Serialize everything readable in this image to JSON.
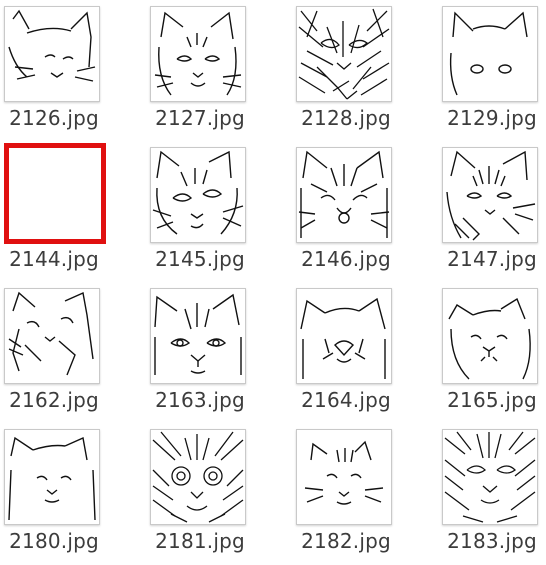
{
  "files": [
    {
      "name": "2126.jpg",
      "selected": false,
      "thumbnail": "cat-sketch-thumbnail"
    },
    {
      "name": "2127.jpg",
      "selected": false,
      "thumbnail": "cat-sketch-thumbnail"
    },
    {
      "name": "2128.jpg",
      "selected": false,
      "thumbnail": "cat-sketch-thumbnail"
    },
    {
      "name": "2129.jpg",
      "selected": false,
      "thumbnail": "cat-sketch-thumbnail"
    },
    {
      "name": "2144.jpg",
      "selected": true,
      "thumbnail": "blank-thumbnail"
    },
    {
      "name": "2145.jpg",
      "selected": false,
      "thumbnail": "cat-sketch-thumbnail"
    },
    {
      "name": "2146.jpg",
      "selected": false,
      "thumbnail": "cat-sketch-thumbnail"
    },
    {
      "name": "2147.jpg",
      "selected": false,
      "thumbnail": "cat-sketch-thumbnail"
    },
    {
      "name": "2162.jpg",
      "selected": false,
      "thumbnail": "cat-sketch-thumbnail"
    },
    {
      "name": "2163.jpg",
      "selected": false,
      "thumbnail": "cat-sketch-thumbnail"
    },
    {
      "name": "2164.jpg",
      "selected": false,
      "thumbnail": "cat-sketch-thumbnail"
    },
    {
      "name": "2165.jpg",
      "selected": false,
      "thumbnail": "cat-sketch-thumbnail"
    },
    {
      "name": "2180.jpg",
      "selected": false,
      "thumbnail": "cat-sketch-thumbnail"
    },
    {
      "name": "2181.jpg",
      "selected": false,
      "thumbnail": "cat-sketch-thumbnail"
    },
    {
      "name": "2182.jpg",
      "selected": false,
      "thumbnail": "cat-sketch-thumbnail"
    },
    {
      "name": "2183.jpg",
      "selected": false,
      "thumbnail": "cat-sketch-thumbnail"
    }
  ],
  "colors": {
    "selection_border": "#e01010",
    "label_text": "#3c3c3c",
    "thumb_border": "#c9c9c9"
  }
}
